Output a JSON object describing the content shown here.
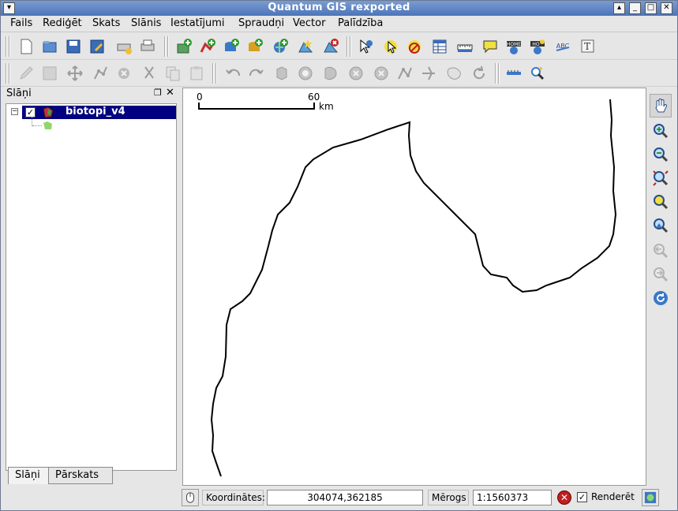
{
  "window": {
    "title": "Quantum GIS rexported"
  },
  "menu": [
    "Fails",
    "Rediģēt",
    "Skats",
    "Slānis",
    "Iestatījumi",
    "Spraudņi",
    "Vector",
    "Palīdzība"
  ],
  "panel": {
    "title": "Slāņi",
    "layer_name": "biotopi_v4",
    "layer_checked": true
  },
  "tabs": [
    "Slāņi",
    "Pārskats"
  ],
  "scale_bar": {
    "start": "0",
    "end": "60",
    "unit": "km"
  },
  "status": {
    "coord_label": "Koordinātes:",
    "coord_value": "304074,362185",
    "scale_label": "Mērogs",
    "scale_value": "1:1560373",
    "render_label": "Renderēt",
    "render_checked": true
  },
  "colors": {
    "title_gradient_top": "#7a9cd0",
    "title_gradient_bottom": "#4c74b8",
    "selected_layer_bg": "#000080",
    "layer_fill": "#8fd66a"
  },
  "icons": {
    "toolbar1": [
      "new-project-icon",
      "open-project-icon",
      "save-project-icon",
      "save-as-icon",
      "print-composer-icon",
      "print-icon",
      "add-raster-icon",
      "add-vector-icon",
      "add-postgis-icon",
      "add-spatialite-icon",
      "add-wms-icon",
      "new-vector-icon",
      "remove-layer-icon",
      "identify-icon",
      "select-icon",
      "deselect-icon",
      "attribute-table-icon",
      "measure-icon",
      "map-tips-icon",
      "home-icon",
      "new-bookmark-icon",
      "label-icon",
      "annotation-icon"
    ],
    "toolbar2": [
      "edit-pencil-icon",
      "save-edits-icon",
      "move-feature-icon",
      "node-tool-icon",
      "delete-feature-icon",
      "cut-icon",
      "copy-icon",
      "paste-icon",
      "undo-icon",
      "redo-icon",
      "simplify-icon",
      "add-ring-icon",
      "add-part-icon",
      "delete-ring-icon",
      "delete-part-icon",
      "reshape-icon",
      "split-icon",
      "merge-icon",
      "rotate-icon",
      "north-arrow-icon",
      "gps-icon"
    ],
    "right": [
      "pan-icon",
      "zoom-in-icon",
      "zoom-out-icon",
      "zoom-full-icon",
      "zoom-layer-icon",
      "zoom-selection-icon",
      "zoom-last-icon",
      "zoom-next-icon",
      "refresh-icon"
    ]
  }
}
